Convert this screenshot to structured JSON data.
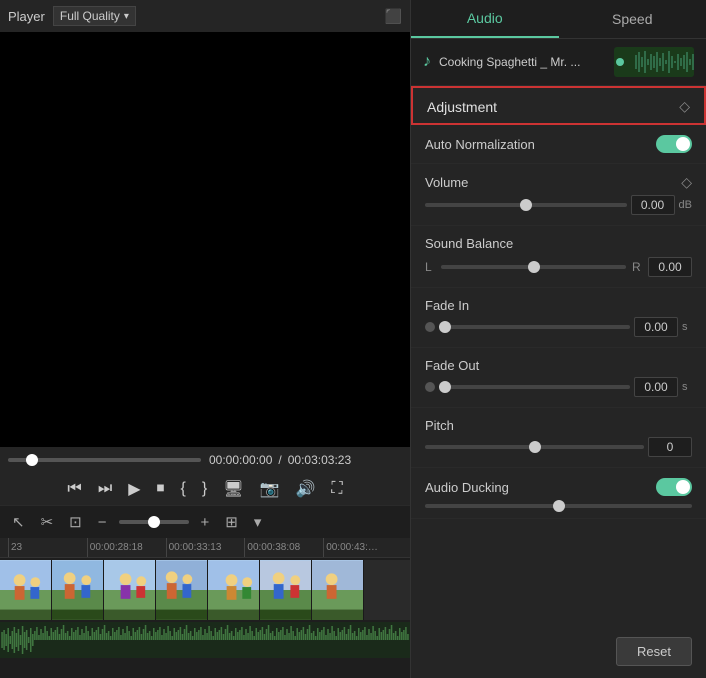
{
  "leftPanel": {
    "topBar": {
      "playerLabel": "Player",
      "qualityLabel": "Full Quality"
    },
    "timeDisplay": {
      "current": "00:00:00:00",
      "separator": "/",
      "total": "00:03:03:23"
    },
    "ruler": {
      "marks": [
        "23",
        "00:00:28:18",
        "00:00:33:13",
        "00:00:38:08",
        "00:00:43:…"
      ]
    }
  },
  "rightPanel": {
    "tabs": [
      {
        "id": "audio",
        "label": "Audio",
        "active": true
      },
      {
        "id": "speed",
        "label": "Speed",
        "active": false
      }
    ],
    "trackInfo": {
      "name": "Cooking Spaghetti _ Mr. ...",
      "musicIcon": "♪"
    },
    "adjustment": {
      "title": "Adjustment",
      "diamondIcon": "◇"
    },
    "autoNormalization": {
      "label": "Auto Normalization",
      "enabled": true
    },
    "volume": {
      "label": "Volume",
      "value": "0.00",
      "unit": "dB",
      "diamondIcon": "◇"
    },
    "soundBalance": {
      "label": "Sound Balance",
      "leftLabel": "L",
      "rightLabel": "R",
      "value": "0.00"
    },
    "fadeIn": {
      "label": "Fade In",
      "value": "0.00",
      "unit": "s"
    },
    "fadeOut": {
      "label": "Fade Out",
      "value": "0.00",
      "unit": "s"
    },
    "pitch": {
      "label": "Pitch",
      "value": "0"
    },
    "audioDucking": {
      "label": "Audio Ducking",
      "enabled": true,
      "sliderValue": "50"
    },
    "resetButton": "Reset"
  }
}
